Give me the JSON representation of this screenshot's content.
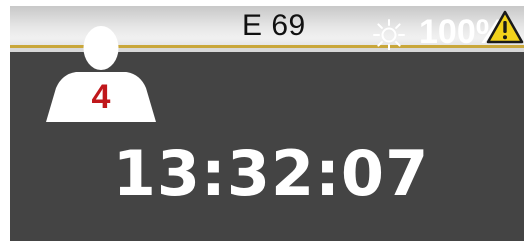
{
  "header": {
    "channel": "E 69",
    "brightness": "100%",
    "brightness_icon": "sun-icon",
    "alert_icon": "warning-icon"
  },
  "player": {
    "icon": "person-icon",
    "number": "4"
  },
  "clock": {
    "time": "13:32:07"
  },
  "colors": {
    "background": "#444444",
    "stripe": "#c9a73a",
    "number": "#c0171b",
    "warning": "#f2d21b"
  }
}
